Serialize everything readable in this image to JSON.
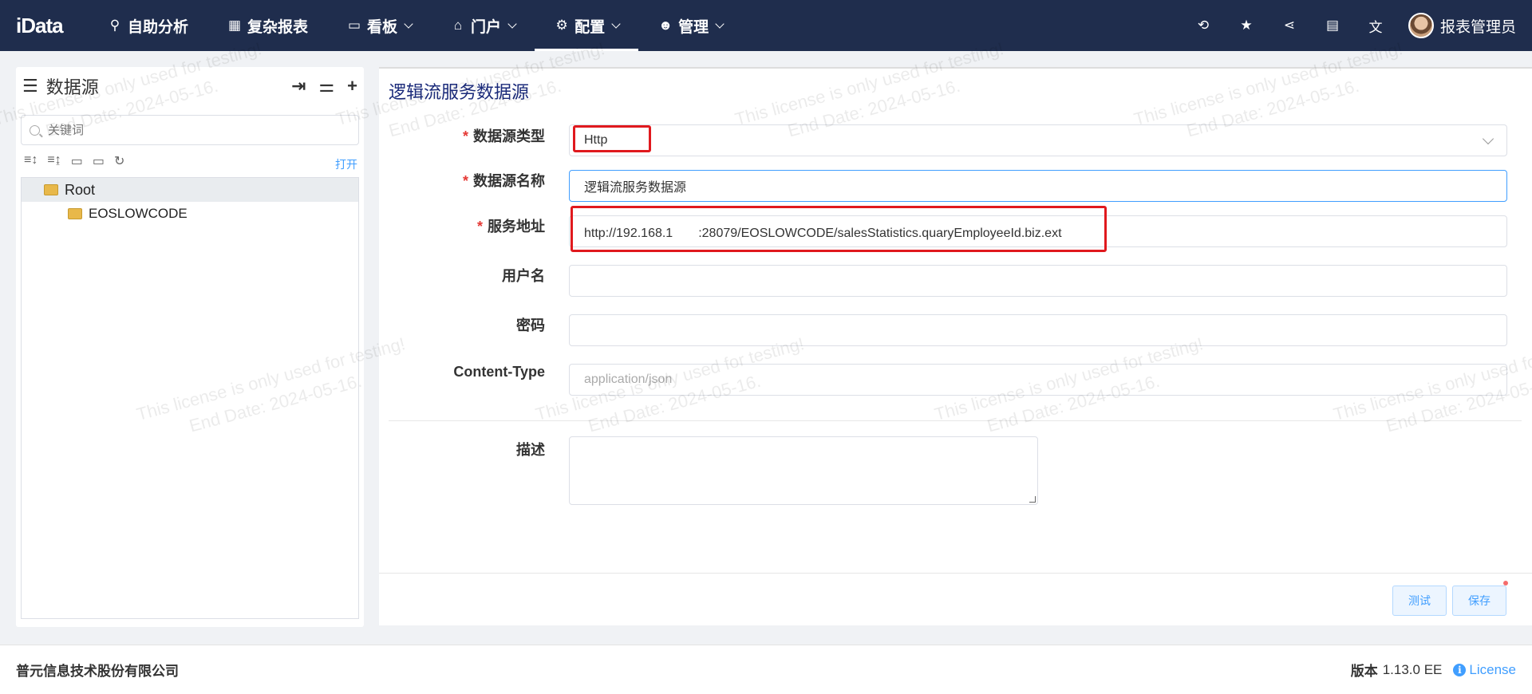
{
  "header": {
    "logo": "iData",
    "nav": [
      {
        "label": "自助分析",
        "icon": "analysis-icon",
        "glyph": "⚲",
        "has_dropdown": false,
        "active": false
      },
      {
        "label": "复杂报表",
        "icon": "table-icon",
        "glyph": "▦",
        "has_dropdown": false,
        "active": false
      },
      {
        "label": "看板",
        "icon": "monitor-icon",
        "glyph": "▭",
        "has_dropdown": true,
        "active": false
      },
      {
        "label": "门户",
        "icon": "bank-icon",
        "glyph": "🏛",
        "has_dropdown": true,
        "active": false
      },
      {
        "label": "配置",
        "icon": "gears-icon",
        "glyph": "⚙",
        "has_dropdown": true,
        "active": true
      },
      {
        "label": "管理",
        "icon": "users-icon",
        "glyph": "👥",
        "has_dropdown": true,
        "active": false
      }
    ],
    "tools": [
      {
        "icon": "history-icon",
        "glyph": "⟲"
      },
      {
        "icon": "star-icon",
        "glyph": "★"
      },
      {
        "icon": "share-icon",
        "glyph": "⋖"
      },
      {
        "icon": "book-icon",
        "glyph": "▤"
      },
      {
        "icon": "translate-icon",
        "glyph": "文"
      }
    ],
    "username": "报表管理员"
  },
  "sidebar": {
    "title": "数据源",
    "search_placeholder": "关键词",
    "open_label": "打开",
    "tree": [
      {
        "label": "Root",
        "level": 0
      },
      {
        "label": "EOSLOWCODE",
        "level": 1
      }
    ]
  },
  "form": {
    "title": "逻辑流服务数据源",
    "type_label": "数据源类型",
    "type_value": "Http",
    "name_label": "数据源名称",
    "name_value": "逻辑流服务数据源",
    "url_label": "服务地址",
    "url_value": "http://192.168.1　　:28079/EOSLOWCODE/salesStatistics.quaryEmployeeId.biz.ext",
    "user_label": "用户名",
    "user_value": "",
    "pwd_label": "密码",
    "pwd_value": "",
    "ct_label": "Content-Type",
    "ct_placeholder": "application/json",
    "desc_label": "描述",
    "test_label": "测试",
    "save_label": "保存"
  },
  "footer": {
    "company": "普元信息技术股份有限公司",
    "version_label": "版本",
    "version_value": "1.13.0 EE",
    "license_label": "License"
  },
  "watermark": {
    "line1": "This license is only used for testing!",
    "line2": "End Date: 2024-05-16."
  },
  "colors": {
    "nav_bg": "#1f2d4d",
    "accent": "#409eff",
    "highlight": "#e0191e"
  }
}
